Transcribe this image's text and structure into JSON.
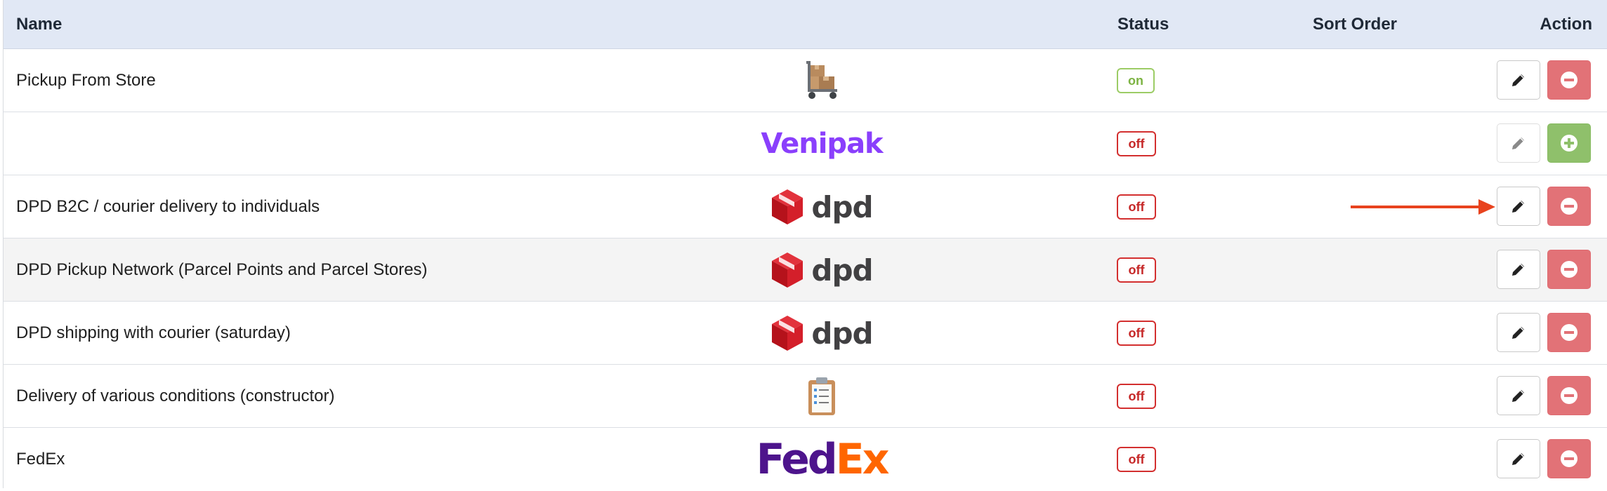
{
  "header": {
    "name": "Name",
    "status": "Status",
    "sort_order": "Sort Order",
    "action": "Action"
  },
  "rows": [
    {
      "name": "Pickup From Store",
      "logo": "cart-boxes-icon",
      "status": "on",
      "edit_enabled": true,
      "action": "remove"
    },
    {
      "name": "",
      "logo": "venipak-logo",
      "logo_text": "Venipak",
      "status": "off",
      "edit_enabled": false,
      "action": "add"
    },
    {
      "name": "DPD B2C / courier delivery to individuals",
      "logo": "dpd-logo",
      "logo_text": "dpd",
      "status": "off",
      "edit_enabled": true,
      "action": "remove",
      "highlighted_by_arrow": true
    },
    {
      "name": "DPD Pickup Network (Parcel Points and Parcel Stores)",
      "logo": "dpd-logo",
      "logo_text": "dpd",
      "status": "off",
      "edit_enabled": true,
      "action": "remove"
    },
    {
      "name": "DPD shipping with courier (saturday)",
      "logo": "dpd-logo",
      "logo_text": "dpd",
      "status": "off",
      "edit_enabled": true,
      "action": "remove"
    },
    {
      "name": "Delivery of various conditions (constructor)",
      "logo": "clipboard-icon",
      "status": "off",
      "edit_enabled": true,
      "action": "remove"
    },
    {
      "name": "FedEx",
      "logo": "fedex-logo",
      "logo_text_a": "Fed",
      "logo_text_b": "Ex",
      "status": "off",
      "edit_enabled": true,
      "action": "remove"
    }
  ],
  "colors": {
    "header_bg": "#e1e8f5",
    "status_on": "#7cb342",
    "status_off": "#c62828",
    "remove_button": "#e27277",
    "add_button": "#8fc06b",
    "arrow": "#e8431e"
  }
}
